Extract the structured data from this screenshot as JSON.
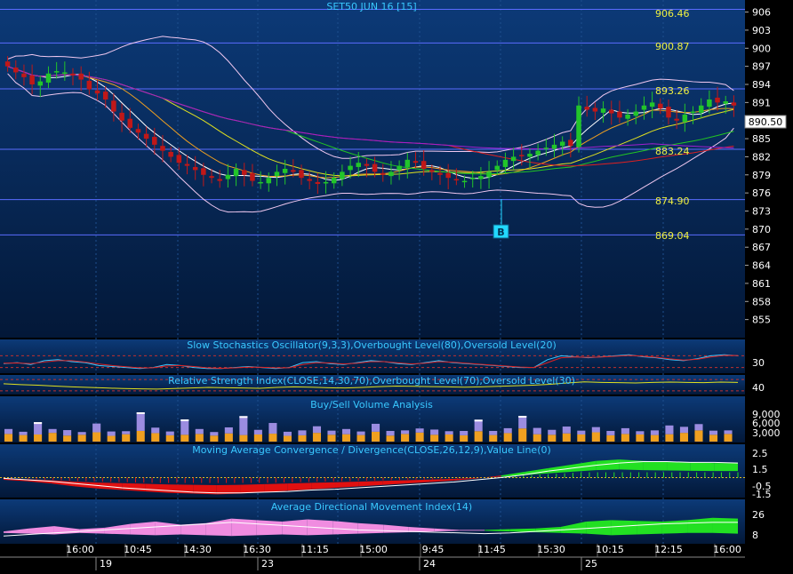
{
  "colors": {
    "panel_top": "#0c3a78",
    "panel_bottom": "#031838",
    "axis_bg": "#000000",
    "title": "#39c8ff",
    "price_label": "#f0f040",
    "level_line": "#5a6cff",
    "candle_up": "#22c52a",
    "candle_down": "#c01818",
    "marker_bg": "#22d8ff",
    "vol_up": "#f0a020",
    "vol_down": "#9b8ce0",
    "vol_top": "#ffffff",
    "macd_pos": "#22e022",
    "macd_neg": "#e01010",
    "adx_pink": "#f08ce0",
    "adx_green": "#22e022",
    "current_price_box": "#ffffff"
  },
  "main": {
    "title": "SET50 JUN 16  [15]",
    "current_price": "890.50",
    "marker": "B",
    "levels": [
      "906.46",
      "900.87",
      "893.26",
      "883.24",
      "874.90",
      "869.04"
    ],
    "yticks": [
      "906",
      "903",
      "900",
      "897",
      "894",
      "891",
      "888",
      "885",
      "882",
      "879",
      "876",
      "873",
      "870",
      "867",
      "864",
      "861",
      "858",
      "855"
    ]
  },
  "stoch": {
    "title": "Slow Stochastics Oscillator(9,3,3),Overbought Level(80),Oversold Level(20)",
    "tick": "30"
  },
  "rsi": {
    "title": "Relative Strength Index(CLOSE,14,30,70),Overbought Level(70),Oversold Level(30)",
    "tick": "40"
  },
  "volume": {
    "title": "Buy/Sell Volume Analysis",
    "ticks": [
      "9,000",
      "6,000",
      "3,000"
    ]
  },
  "macd": {
    "title": "Moving Average Convergence / Divergence(CLOSE,26,12,9),Value Line(0)",
    "ticks": [
      "2.5",
      "1.5",
      "-0.5",
      "-1.5"
    ]
  },
  "adx": {
    "title": "Average Directional Movement Index(14)",
    "ticks": [
      "26",
      "8"
    ]
  },
  "xaxis": {
    "times": [
      "16:00",
      "10:45",
      "14:30",
      "16:30",
      "11:15",
      "15:00",
      "9:45",
      "11:45",
      "15:30",
      "10:15",
      "12:15",
      "16:00"
    ],
    "days": [
      "19",
      "23",
      "24",
      "25"
    ]
  },
  "chart_data": [
    {
      "type": "candlestick",
      "title": "SET50 JUN 16  [15]",
      "ylim": [
        852,
        908
      ],
      "reference_levels": [
        906.46,
        900.87,
        893.26,
        883.24,
        874.9,
        869.04
      ],
      "last": 890.5,
      "close": [
        897.0,
        896.0,
        895.2,
        894.0,
        894.5,
        895.8,
        896.2,
        896.0,
        895.5,
        894.8,
        893.2,
        892.5,
        891.5,
        889.5,
        888.0,
        886.8,
        886.0,
        885.0,
        884.0,
        883.0,
        882.0,
        881.0,
        880.5,
        879.8,
        879.0,
        878.5,
        878.0,
        879.0,
        880.0,
        879.0,
        878.0,
        877.8,
        878.5,
        879.5,
        880.0,
        879.5,
        878.5,
        878.0,
        877.5,
        877.8,
        878.5,
        879.5,
        880.5,
        881.0,
        880.5,
        879.5,
        879.0,
        879.5,
        880.5,
        881.5,
        881.0,
        880.0,
        879.5,
        879.0,
        878.5,
        878.2,
        878.0,
        878.5,
        878.8,
        879.5,
        880.5,
        881.5,
        882.0,
        882.2,
        882.5,
        883.0,
        883.5,
        884.0,
        884.5,
        883.8,
        890.5,
        889.8,
        889.5,
        890.0,
        889.2,
        888.5,
        889.0,
        889.5,
        890.5,
        891.0,
        890.0,
        888.5,
        888.0,
        889.0,
        889.5,
        890.5,
        891.5,
        891.0,
        891.2,
        890.5
      ],
      "markers": [
        {
          "label": "B",
          "index": 56
        }
      ]
    },
    {
      "type": "line",
      "title": "Slow Stochastics Oscillator(9,3,3),Overbought Level(80),Oversold Level(20)",
      "ylim": [
        0,
        100
      ],
      "series": [
        {
          "values": [
            40,
            45,
            35,
            55,
            60,
            50,
            45,
            30,
            25,
            20,
            15,
            20,
            35,
            30,
            20,
            15,
            15,
            20,
            25,
            20,
            15,
            20,
            45,
            50,
            40,
            35,
            45,
            55,
            50,
            40,
            35,
            45,
            55,
            45,
            40,
            35,
            30,
            25,
            20,
            20,
            60,
            80,
            75,
            70,
            75,
            80,
            85,
            75,
            70,
            60,
            55,
            65,
            80,
            85,
            80
          ]
        },
        {
          "values": [
            42,
            43,
            40,
            48,
            55,
            55,
            48,
            38,
            30,
            24,
            18,
            19,
            28,
            30,
            25,
            18,
            16,
            18,
            22,
            21,
            18,
            19,
            35,
            45,
            43,
            38,
            42,
            50,
            50,
            44,
            38,
            42,
            50,
            47,
            42,
            37,
            32,
            27,
            22,
            20,
            45,
            70,
            74,
            72,
            74,
            78,
            82,
            78,
            72,
            64,
            58,
            62,
            74,
            82,
            81
          ]
        }
      ]
    },
    {
      "type": "line",
      "title": "Relative Strength Index(CLOSE,14,30,70),Overbought Level(70),Oversold Level(30)",
      "ylim": [
        20,
        80
      ],
      "series": [
        {
          "values": [
            55,
            52,
            50,
            47,
            44,
            42,
            40,
            38,
            37,
            36,
            38,
            40,
            42,
            41,
            40,
            39,
            42,
            44,
            43,
            41,
            40,
            42,
            45,
            47,
            46,
            45,
            44,
            43,
            44,
            46,
            48,
            50,
            53,
            58,
            62,
            60,
            59,
            58,
            60,
            61,
            60,
            59,
            61,
            60
          ]
        }
      ]
    },
    {
      "type": "bar",
      "title": "Buy/Sell Volume Analysis",
      "ylim": [
        0,
        12000
      ],
      "series": [
        {
          "name": "up",
          "values": [
            2800,
            2400,
            2600,
            3200,
            2200,
            2500,
            3400,
            2100,
            2700,
            3900,
            3100,
            2300,
            2500,
            2800,
            2200,
            3000,
            2400,
            2600,
            2900,
            2100,
            2300,
            3200,
            2500,
            2700,
            2400,
            3600,
            2200,
            2800,
            3300,
            2500,
            2600,
            2300,
            3800,
            2400,
            3100,
            4800,
            2700,
            2500,
            3000,
            2600,
            3400,
            2300,
            2800,
            2600,
            2400,
            2700,
            3200,
            4100,
            2500,
            2800
          ]
        },
        {
          "name": "down",
          "values": [
            1800,
            1200,
            4500,
            1400,
            2000,
            1000,
            3200,
            1600,
            1100,
            6800,
            2000,
            1400,
            5600,
            1800,
            1300,
            2200,
            6900,
            1700,
            3900,
            1500,
            1800,
            2400,
            1500,
            1900,
            1300,
            2900,
            1700,
            1300,
            1500,
            1900,
            1200,
            1600,
            4200,
            1500,
            1800,
            4600,
            2300,
            1800,
            2500,
            1400,
            1900,
            1600,
            2100,
            1200,
            1700,
            3200,
            2200,
            2300,
            1500,
            1300
          ]
        }
      ]
    },
    {
      "type": "line",
      "title": "Moving Average Convergence / Divergence(CLOSE,26,12,9),Value Line(0)",
      "ylim": [
        -2.5,
        3.0
      ],
      "reference_levels": [
        0
      ],
      "series": [
        {
          "values": [
            -0.3,
            -0.5,
            -0.8,
            -1.2,
            -1.5,
            -1.7,
            -1.9,
            -2.1,
            -2.2,
            -2.3,
            -2.2,
            -2.0,
            -1.8,
            -1.6,
            -1.4,
            -1.2,
            -1.0,
            -0.8,
            -0.6,
            -0.4,
            -0.1,
            0.3,
            0.8,
            1.3,
            1.8,
            2.3,
            2.5,
            2.3,
            2.2,
            2.1,
            2.0,
            2.0
          ]
        },
        {
          "values": [
            -0.1,
            -0.3,
            -0.5,
            -0.8,
            -1.1,
            -1.4,
            -1.6,
            -1.8,
            -2.0,
            -2.1,
            -2.1,
            -2.0,
            -1.9,
            -1.7,
            -1.6,
            -1.4,
            -1.2,
            -1.0,
            -0.8,
            -0.6,
            -0.3,
            0.0,
            0.4,
            0.9,
            1.3,
            1.7,
            2.0,
            2.2,
            2.2,
            2.1,
            2.1,
            2.0
          ]
        }
      ]
    },
    {
      "type": "area",
      "title": "Average Directional Movement Index(14)",
      "ylim": [
        0,
        40
      ],
      "series": [
        {
          "values": [
            14,
            18,
            21,
            17,
            19,
            24,
            27,
            23,
            25,
            31,
            29,
            27,
            30,
            28,
            25,
            23,
            20,
            18,
            16,
            15,
            14,
            13,
            12,
            11,
            9,
            10,
            11,
            12,
            12,
            11
          ]
        },
        {
          "values": [
            12,
            11,
            10,
            12,
            11,
            10,
            9,
            10,
            9,
            8,
            9,
            10,
            9,
            10,
            11,
            12,
            13,
            14,
            15,
            16,
            17,
            18,
            20,
            27,
            29,
            28,
            27,
            29,
            32,
            31
          ]
        },
        {
          "values": [
            8,
            10,
            12,
            14,
            16,
            18,
            20,
            22,
            24,
            26,
            24,
            22,
            20,
            18,
            16,
            15,
            14,
            13,
            12,
            11,
            12,
            14,
            16,
            18,
            20,
            22,
            24,
            25,
            26,
            26
          ]
        }
      ]
    }
  ]
}
